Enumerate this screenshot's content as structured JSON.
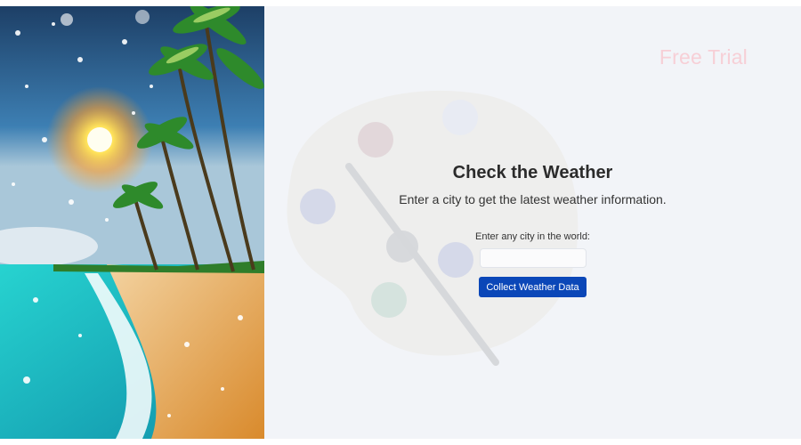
{
  "hero": {
    "image": "tropical-beach-snow-sun",
    "colors": {
      "sky": "#2a5d8c",
      "sun": "#ffd84a",
      "sea": "#1fc7c7",
      "sand": "#e39a3a"
    }
  },
  "background": {
    "icon": "paint-palette-icon"
  },
  "header": {
    "free_trial": "Free Trial"
  },
  "main": {
    "title": "Check the Weather",
    "subtitle": "Enter a city to get the latest weather information.",
    "city_label": "Enter any city in the world:",
    "city_value": "",
    "city_placeholder": "",
    "submit_label": "Collect Weather Data"
  },
  "colors": {
    "accent": "#0b47b8",
    "panel_bg": "#f2f4f8",
    "free_trial_text": "#f7cfd6"
  }
}
